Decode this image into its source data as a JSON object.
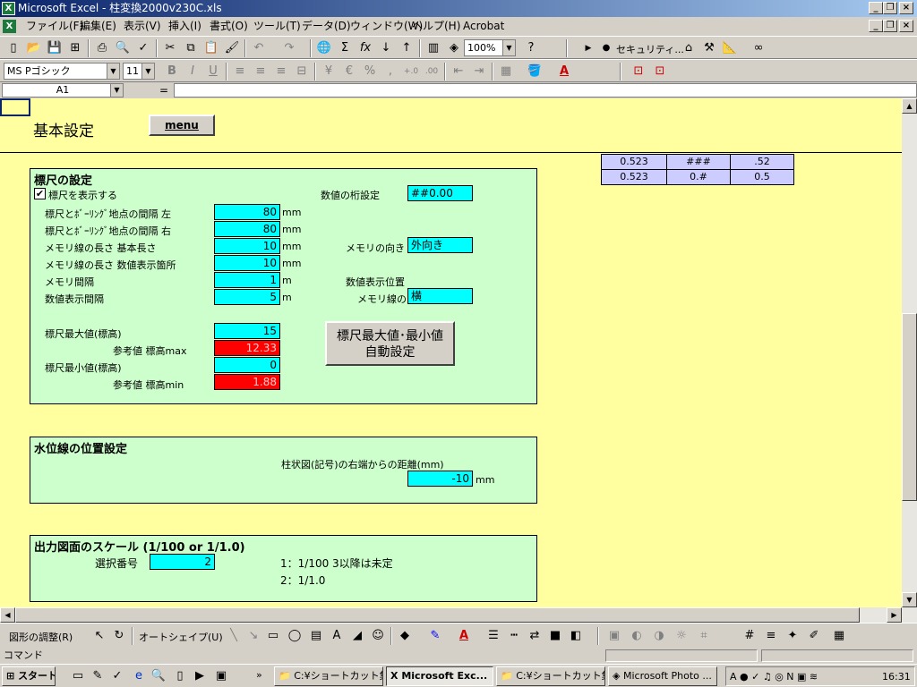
{
  "window": {
    "title": "Microsoft Excel - 柱変換2000v230C.xls"
  },
  "menu": [
    "ファイル(F)",
    "編集(E)",
    "表示(V)",
    "挿入(I)",
    "書式(O)",
    "ツール(T)",
    "データ(D)",
    "ウィンドウ(W)",
    "ヘルプ(H)",
    "Acrobat"
  ],
  "toolbar": {
    "zoom": "100%",
    "security": "セキュリティ..."
  },
  "format": {
    "font": "MS Pゴシック",
    "size": "11"
  },
  "namebox": "A1",
  "formula_eq": "=",
  "sheet": {
    "title": "基本設定",
    "menu_button": "menu",
    "ruler": {
      "title": "標尺の設定",
      "show_label": "標尺を表示する",
      "rows": [
        {
          "label": "標尺とﾎﾞｰﾘﾝｸﾞ地点の間隔 左",
          "value": "80",
          "unit": "mm"
        },
        {
          "label": "標尺とﾎﾞｰﾘﾝｸﾞ地点の間隔 右",
          "value": "80",
          "unit": "mm"
        },
        {
          "label": "メモリ線の長さ 基本長さ",
          "value": "10",
          "unit": "mm"
        },
        {
          "label": "メモリ線の長さ 数値表示箇所",
          "value": "10",
          "unit": "mm"
        },
        {
          "label": "メモリ間隔",
          "value": "1",
          "unit": "m"
        },
        {
          "label": "数値表示間隔",
          "value": "5",
          "unit": "m"
        }
      ],
      "digits_label": "数値の桁設定",
      "digits_value": "##0.00",
      "direction_label": "メモリの向き",
      "direction_value": "外向き",
      "pos_label1": "数値表示位置",
      "pos_label2": "メモリ線の",
      "pos_value": "横",
      "max_label": "標尺最大値(標高)",
      "max_value": "15",
      "ref_max_label": "参考値 標高max",
      "ref_max_value": "12.33",
      "min_label": "標尺最小値(標高)",
      "min_value": "0",
      "ref_min_label": "参考値 標高min",
      "ref_min_value": "1.88",
      "auto_button_l1": "標尺最大値･最小値",
      "auto_button_l2": "自動設定"
    },
    "water": {
      "title": "水位線の位置設定",
      "desc": "柱状図(記号)の右端からの距離(mm)",
      "value": "-10",
      "unit": "mm"
    },
    "scale": {
      "title": "出力図面のスケール (1/100 or 1/1.0)",
      "sel_label": "選択番号",
      "sel_value": "2",
      "opt1": "1：1/100 3以降は未定",
      "opt2": "2：1/1.0"
    },
    "grid": [
      [
        "0.523",
        "###",
        ".52"
      ],
      [
        "0.523",
        "0.#",
        "0.5"
      ]
    ]
  },
  "draw": {
    "adjust": "図形の調整(R)",
    "autoshape": "オートシェイプ(U)"
  },
  "status": "コマンド",
  "taskbar": {
    "start": "スタート",
    "tasks": [
      "C:¥ショートカット集...",
      "Microsoft Exc...",
      "C:¥ショートカット集...",
      "Microsoft Photo ..."
    ],
    "clock": "16:31"
  }
}
